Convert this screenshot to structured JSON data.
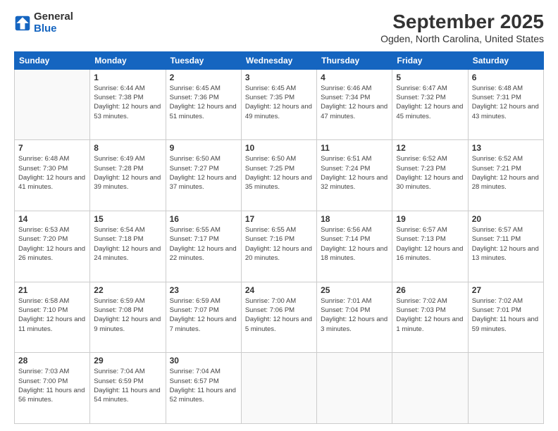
{
  "header": {
    "logo_general": "General",
    "logo_blue": "Blue",
    "month": "September 2025",
    "location": "Ogden, North Carolina, United States"
  },
  "weekdays": [
    "Sunday",
    "Monday",
    "Tuesday",
    "Wednesday",
    "Thursday",
    "Friday",
    "Saturday"
  ],
  "weeks": [
    [
      {
        "day": "",
        "sunrise": "",
        "sunset": "",
        "daylight": ""
      },
      {
        "day": "1",
        "sunrise": "Sunrise: 6:44 AM",
        "sunset": "Sunset: 7:38 PM",
        "daylight": "Daylight: 12 hours and 53 minutes."
      },
      {
        "day": "2",
        "sunrise": "Sunrise: 6:45 AM",
        "sunset": "Sunset: 7:36 PM",
        "daylight": "Daylight: 12 hours and 51 minutes."
      },
      {
        "day": "3",
        "sunrise": "Sunrise: 6:45 AM",
        "sunset": "Sunset: 7:35 PM",
        "daylight": "Daylight: 12 hours and 49 minutes."
      },
      {
        "day": "4",
        "sunrise": "Sunrise: 6:46 AM",
        "sunset": "Sunset: 7:34 PM",
        "daylight": "Daylight: 12 hours and 47 minutes."
      },
      {
        "day": "5",
        "sunrise": "Sunrise: 6:47 AM",
        "sunset": "Sunset: 7:32 PM",
        "daylight": "Daylight: 12 hours and 45 minutes."
      },
      {
        "day": "6",
        "sunrise": "Sunrise: 6:48 AM",
        "sunset": "Sunset: 7:31 PM",
        "daylight": "Daylight: 12 hours and 43 minutes."
      }
    ],
    [
      {
        "day": "7",
        "sunrise": "Sunrise: 6:48 AM",
        "sunset": "Sunset: 7:30 PM",
        "daylight": "Daylight: 12 hours and 41 minutes."
      },
      {
        "day": "8",
        "sunrise": "Sunrise: 6:49 AM",
        "sunset": "Sunset: 7:28 PM",
        "daylight": "Daylight: 12 hours and 39 minutes."
      },
      {
        "day": "9",
        "sunrise": "Sunrise: 6:50 AM",
        "sunset": "Sunset: 7:27 PM",
        "daylight": "Daylight: 12 hours and 37 minutes."
      },
      {
        "day": "10",
        "sunrise": "Sunrise: 6:50 AM",
        "sunset": "Sunset: 7:25 PM",
        "daylight": "Daylight: 12 hours and 35 minutes."
      },
      {
        "day": "11",
        "sunrise": "Sunrise: 6:51 AM",
        "sunset": "Sunset: 7:24 PM",
        "daylight": "Daylight: 12 hours and 32 minutes."
      },
      {
        "day": "12",
        "sunrise": "Sunrise: 6:52 AM",
        "sunset": "Sunset: 7:23 PM",
        "daylight": "Daylight: 12 hours and 30 minutes."
      },
      {
        "day": "13",
        "sunrise": "Sunrise: 6:52 AM",
        "sunset": "Sunset: 7:21 PM",
        "daylight": "Daylight: 12 hours and 28 minutes."
      }
    ],
    [
      {
        "day": "14",
        "sunrise": "Sunrise: 6:53 AM",
        "sunset": "Sunset: 7:20 PM",
        "daylight": "Daylight: 12 hours and 26 minutes."
      },
      {
        "day": "15",
        "sunrise": "Sunrise: 6:54 AM",
        "sunset": "Sunset: 7:18 PM",
        "daylight": "Daylight: 12 hours and 24 minutes."
      },
      {
        "day": "16",
        "sunrise": "Sunrise: 6:55 AM",
        "sunset": "Sunset: 7:17 PM",
        "daylight": "Daylight: 12 hours and 22 minutes."
      },
      {
        "day": "17",
        "sunrise": "Sunrise: 6:55 AM",
        "sunset": "Sunset: 7:16 PM",
        "daylight": "Daylight: 12 hours and 20 minutes."
      },
      {
        "day": "18",
        "sunrise": "Sunrise: 6:56 AM",
        "sunset": "Sunset: 7:14 PM",
        "daylight": "Daylight: 12 hours and 18 minutes."
      },
      {
        "day": "19",
        "sunrise": "Sunrise: 6:57 AM",
        "sunset": "Sunset: 7:13 PM",
        "daylight": "Daylight: 12 hours and 16 minutes."
      },
      {
        "day": "20",
        "sunrise": "Sunrise: 6:57 AM",
        "sunset": "Sunset: 7:11 PM",
        "daylight": "Daylight: 12 hours and 13 minutes."
      }
    ],
    [
      {
        "day": "21",
        "sunrise": "Sunrise: 6:58 AM",
        "sunset": "Sunset: 7:10 PM",
        "daylight": "Daylight: 12 hours and 11 minutes."
      },
      {
        "day": "22",
        "sunrise": "Sunrise: 6:59 AM",
        "sunset": "Sunset: 7:08 PM",
        "daylight": "Daylight: 12 hours and 9 minutes."
      },
      {
        "day": "23",
        "sunrise": "Sunrise: 6:59 AM",
        "sunset": "Sunset: 7:07 PM",
        "daylight": "Daylight: 12 hours and 7 minutes."
      },
      {
        "day": "24",
        "sunrise": "Sunrise: 7:00 AM",
        "sunset": "Sunset: 7:06 PM",
        "daylight": "Daylight: 12 hours and 5 minutes."
      },
      {
        "day": "25",
        "sunrise": "Sunrise: 7:01 AM",
        "sunset": "Sunset: 7:04 PM",
        "daylight": "Daylight: 12 hours and 3 minutes."
      },
      {
        "day": "26",
        "sunrise": "Sunrise: 7:02 AM",
        "sunset": "Sunset: 7:03 PM",
        "daylight": "Daylight: 12 hours and 1 minute."
      },
      {
        "day": "27",
        "sunrise": "Sunrise: 7:02 AM",
        "sunset": "Sunset: 7:01 PM",
        "daylight": "Daylight: 11 hours and 59 minutes."
      }
    ],
    [
      {
        "day": "28",
        "sunrise": "Sunrise: 7:03 AM",
        "sunset": "Sunset: 7:00 PM",
        "daylight": "Daylight: 11 hours and 56 minutes."
      },
      {
        "day": "29",
        "sunrise": "Sunrise: 7:04 AM",
        "sunset": "Sunset: 6:59 PM",
        "daylight": "Daylight: 11 hours and 54 minutes."
      },
      {
        "day": "30",
        "sunrise": "Sunrise: 7:04 AM",
        "sunset": "Sunset: 6:57 PM",
        "daylight": "Daylight: 11 hours and 52 minutes."
      },
      {
        "day": "",
        "sunrise": "",
        "sunset": "",
        "daylight": ""
      },
      {
        "day": "",
        "sunrise": "",
        "sunset": "",
        "daylight": ""
      },
      {
        "day": "",
        "sunrise": "",
        "sunset": "",
        "daylight": ""
      },
      {
        "day": "",
        "sunrise": "",
        "sunset": "",
        "daylight": ""
      }
    ]
  ]
}
